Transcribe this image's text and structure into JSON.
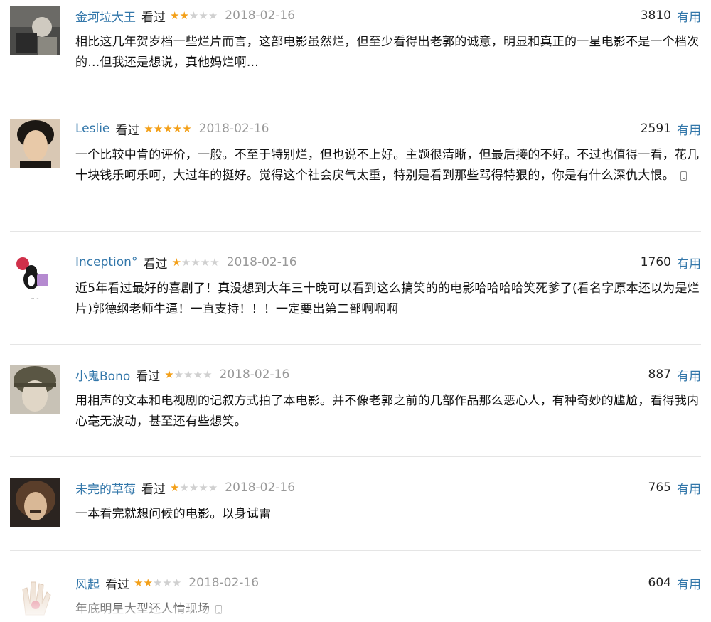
{
  "comments": [
    {
      "user": "金坷垃大王",
      "status": "看过",
      "rating": 2,
      "date": "2018-02-16",
      "votes": "3810",
      "vote_label": "有用",
      "text": "相比这几年贺岁档一些烂片而言，这部电影虽然烂，但至少看得出老郭的诚意，明显和真正的一星电影不是一个档次的…但我还是想说，真他妈烂啊…",
      "mobile": false,
      "avatar_icon": "user-avatar-1"
    },
    {
      "user": "Leslie",
      "status": "看过",
      "rating": 5,
      "date": "2018-02-16",
      "votes": "2591",
      "vote_label": "有用",
      "text": "一个比较中肯的评价，一般。不至于特别烂，但也说不上好。主题很清晰，但最后接的不好。不过也值得一看，花几十块钱乐呵乐呵，大过年的挺好。觉得这个社会戾气太重，特别是看到那些骂得特狠的，你是有什么深仇大恨。",
      "mobile": true,
      "avatar_icon": "user-avatar-2"
    },
    {
      "user": "Inception°",
      "status": "看过",
      "rating": 1,
      "date": "2018-02-16",
      "votes": "1760",
      "vote_label": "有用",
      "text": "近5年看过最好的喜剧了！真没想到大年三十晚可以看到这么搞笑的的电影哈哈哈哈笑死爹了(看名字原本还以为是烂片)郭德纲老师牛逼！一直支持！！！一定要出第二部啊啊啊",
      "mobile": false,
      "avatar_icon": "user-avatar-3"
    },
    {
      "user": "小鬼Bono",
      "status": "看过",
      "rating": 1,
      "date": "2018-02-16",
      "votes": "887",
      "vote_label": "有用",
      "text": "用相声的文本和电视剧的记叙方式拍了本电影。并不像老郭之前的几部作品那么恶心人，有种奇妙的尴尬，看得我内心毫无波动，甚至还有些想笑。",
      "mobile": false,
      "avatar_icon": "user-avatar-4"
    },
    {
      "user": "未完的草莓",
      "status": "看过",
      "rating": 1,
      "date": "2018-02-16",
      "votes": "765",
      "vote_label": "有用",
      "text": "一本看完就想问候的电影。以身试雷",
      "mobile": false,
      "avatar_icon": "user-avatar-5"
    },
    {
      "user": "风起",
      "status": "看过",
      "rating": 2,
      "date": "2018-02-16",
      "votes": "604",
      "vote_label": "有用",
      "text": "年底明星大型还人情现场",
      "mobile": true,
      "avatar_icon": "user-avatar-6"
    }
  ],
  "colors": {
    "link": "#3377aa",
    "star_on": "#f3a019",
    "star_off": "#d0d0d0",
    "date": "#999999",
    "divider": "#e5e5e5"
  },
  "icons": {
    "star": "★",
    "mobile": "phone-icon"
  }
}
